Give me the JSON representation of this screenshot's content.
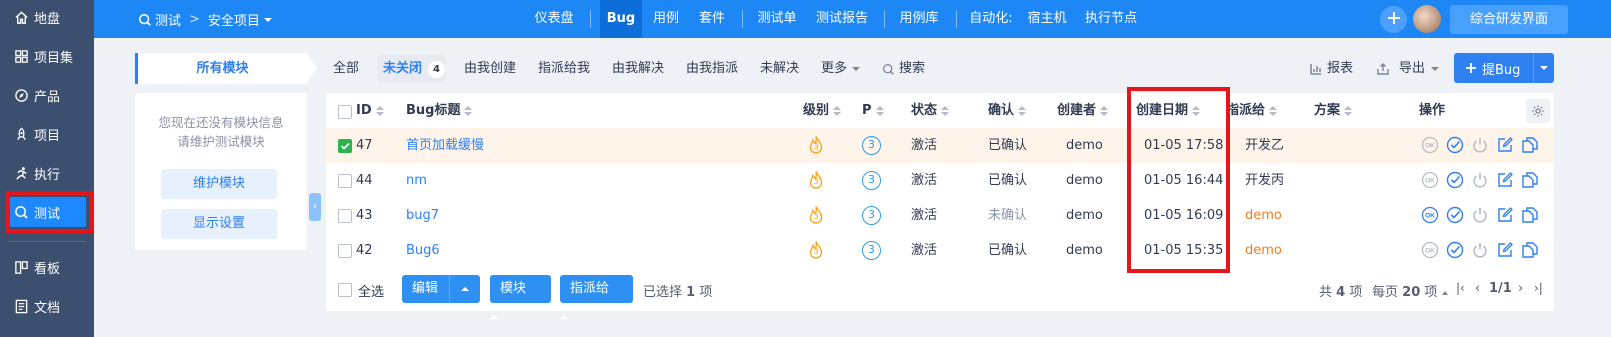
{
  "sidebar": {
    "items": [
      {
        "label": "地盘",
        "icon": "home-icon"
      },
      {
        "label": "项目集",
        "icon": "grid-icon"
      },
      {
        "label": "产品",
        "icon": "compass-icon"
      },
      {
        "label": "项目",
        "icon": "rocket-icon"
      },
      {
        "label": "执行",
        "icon": "run-icon"
      },
      {
        "label": "测试",
        "icon": "search-icon",
        "active": true
      },
      {
        "label": "看板",
        "icon": "kanban-icon"
      },
      {
        "label": "文档",
        "icon": "doc-icon"
      }
    ]
  },
  "topbar": {
    "breadcrumb": {
      "module": "测试",
      "project": "安全项目"
    },
    "nav": [
      "仪表盘",
      "Bug",
      "用例",
      "套件",
      "测试单",
      "测试报告",
      "用例库",
      "自动化:",
      "宿主机",
      "执行节点"
    ],
    "active_nav": "Bug",
    "theme_button": "综合研发界面"
  },
  "module_panel": {
    "tab_label": "所有模块",
    "empty_line1": "您现在还没有模块信息",
    "empty_line2": "请维护测试模块",
    "maintain_button": "维护模块",
    "display_settings_button": "显示设置"
  },
  "filters": {
    "all": "全部",
    "unclosed": "未关闭",
    "unclosed_count": "4",
    "created_by_me": "由我创建",
    "assigned_to_me": "指派给我",
    "resolved_by_me": "由我解决",
    "assigned_by_me": "由我指派",
    "unresolved": "未解决",
    "more": "更多",
    "search": "搜索"
  },
  "toolbar": {
    "report": "报表",
    "export": "导出",
    "add_bug": "提Bug"
  },
  "table": {
    "columns": {
      "id": "ID",
      "title": "Bug标题",
      "severity": "级别",
      "priority": "P",
      "status": "状态",
      "confirmed": "确认",
      "creator": "创建者",
      "created_date": "创建日期",
      "assigned_to": "指派给",
      "resolution": "方案",
      "actions": "操作"
    },
    "rows": [
      {
        "id": "47",
        "title": "首页加载缓慢",
        "severity": "3",
        "priority": "3",
        "status": "激活",
        "confirmed": "已确认",
        "creator": "demo",
        "created_date": "01-05 17:58",
        "assigned_to": "开发乙",
        "checked": true
      },
      {
        "id": "44",
        "title": "nm",
        "severity": "3",
        "priority": "3",
        "status": "激活",
        "confirmed": "已确认",
        "creator": "demo",
        "created_date": "01-05 16:44",
        "assigned_to": "开发丙",
        "checked": false
      },
      {
        "id": "43",
        "title": "bug7",
        "severity": "3",
        "priority": "3",
        "status": "激活",
        "confirmed": "未确认",
        "creator": "demo",
        "created_date": "01-05 16:09",
        "assigned_to": "demo",
        "checked": false
      },
      {
        "id": "42",
        "title": "Bug6",
        "severity": "3",
        "priority": "3",
        "status": "激活",
        "confirmed": "已确认",
        "creator": "demo",
        "created_date": "01-05 15:35",
        "assigned_to": "demo",
        "checked": false
      }
    ]
  },
  "footer": {
    "select_all": "全选",
    "edit": "编辑",
    "module": "模块",
    "assign_to": "指派给",
    "selected_text": "已选择",
    "selected_count": "1",
    "selected_unit": "项",
    "total_prefix": "共",
    "total": "4",
    "total_unit": "项",
    "per_page_prefix": "每页",
    "per_page": "20",
    "per_page_unit": "项",
    "page": "1/1"
  },
  "colors": {
    "primary": "#2e7ff0",
    "sidebar": "#3c4f6f",
    "topbar": "#1c87f5",
    "highlight_box": "#e5151c",
    "selected_row": "#fff4ea"
  }
}
